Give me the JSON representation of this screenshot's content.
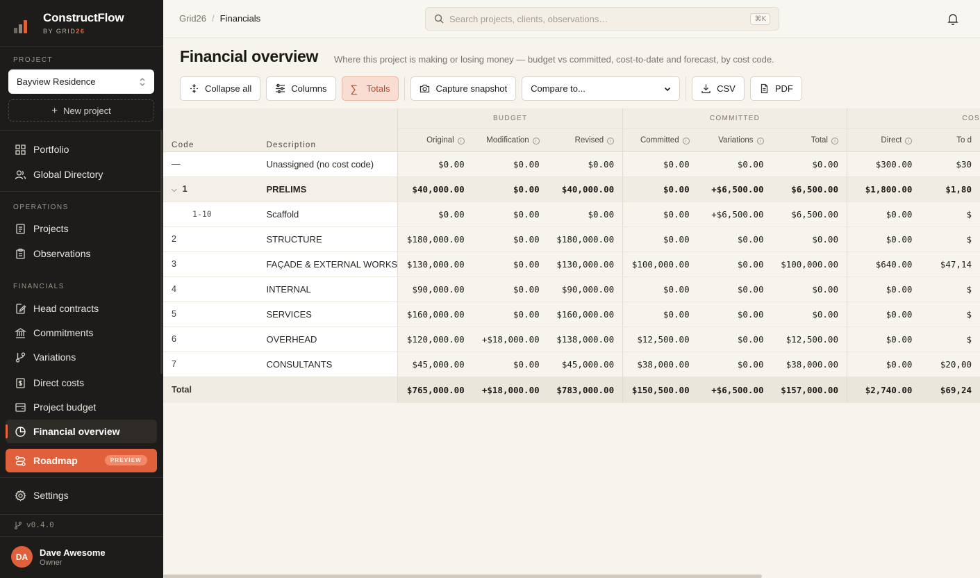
{
  "brand": {
    "name": "ConstructFlow",
    "sub_prefix": "BY GRID",
    "sub_accent": "26"
  },
  "sidebar": {
    "project_section": "PROJECT",
    "project_selected": "Bayview Residence",
    "new_project": "New project",
    "top_items": [
      {
        "label": "Portfolio",
        "icon": "grid-icon"
      },
      {
        "label": "Global Directory",
        "icon": "users-icon"
      }
    ],
    "operations_section": "OPERATIONS",
    "operations_items": [
      {
        "label": "Projects",
        "icon": "briefcase-icon"
      },
      {
        "label": "Observations",
        "icon": "clipboard-icon"
      }
    ],
    "financials_section": "FINANCIALS",
    "financials_items": [
      {
        "label": "Head contracts",
        "icon": "file-pen-icon"
      },
      {
        "label": "Commitments",
        "icon": "bank-icon"
      },
      {
        "label": "Variations",
        "icon": "branch-icon"
      },
      {
        "label": "Direct costs",
        "icon": "receipt-icon"
      },
      {
        "label": "Project budget",
        "icon": "folder-icon"
      },
      {
        "label": "Financial overview",
        "icon": "pie-chart-icon",
        "active": true
      }
    ],
    "roadmap": {
      "label": "Roadmap",
      "badge": "PREVIEW",
      "icon": "route-icon"
    },
    "settings": {
      "label": "Settings",
      "icon": "gear-icon"
    },
    "version": "v0.4.0",
    "user": {
      "initials": "DA",
      "name": "Dave Awesome",
      "role": "Owner"
    }
  },
  "topbar": {
    "breadcrumb_root": "Grid26",
    "breadcrumb_sep": "/",
    "breadcrumb_current": "Financials",
    "search_placeholder": "Search projects, clients, observations…",
    "search_shortcut": "⌘K"
  },
  "page": {
    "title": "Financial overview",
    "subtitle": "Where this project is making or losing money — budget vs committed, cost-to-date and forecast, by cost code."
  },
  "toolbar": {
    "collapse_all": "Collapse all",
    "columns": "Columns",
    "totals": "Totals",
    "capture_snapshot": "Capture snapshot",
    "compare_to": "Compare to...",
    "csv": "CSV",
    "pdf": "PDF"
  },
  "table": {
    "groups": {
      "budget": "BUDGET",
      "committed": "COMMITTED",
      "cost": "COS"
    },
    "headers": {
      "code": "Code",
      "description": "Description",
      "original": "Original",
      "modification": "Modification",
      "revised": "Revised",
      "committed": "Committed",
      "variations": "Variations",
      "total": "Total",
      "direct": "Direct",
      "to_date": "To d"
    },
    "rows": [
      {
        "code": "—",
        "desc": "Unassigned (no cost code)",
        "type": "plain",
        "values": [
          "$0.00",
          "$0.00",
          "$0.00",
          "$0.00",
          "$0.00",
          "$0.00",
          "$300.00",
          "$30"
        ]
      },
      {
        "code": "1",
        "desc": "PRELIMS",
        "type": "parent",
        "values": [
          "$40,000.00",
          "$0.00",
          "$40,000.00",
          "$0.00",
          "+$6,500.00",
          "$6,500.00",
          "$1,800.00",
          "$1,80"
        ]
      },
      {
        "code": "1-10",
        "desc": "Scaffold",
        "type": "child",
        "values": [
          "$0.00",
          "$0.00",
          "$0.00",
          "$0.00",
          "+$6,500.00",
          "$6,500.00",
          "$0.00",
          "$"
        ]
      },
      {
        "code": "2",
        "desc": "STRUCTURE",
        "type": "plain",
        "values": [
          "$180,000.00",
          "$0.00",
          "$180,000.00",
          "$0.00",
          "$0.00",
          "$0.00",
          "$0.00",
          "$"
        ]
      },
      {
        "code": "3",
        "desc": "FAÇADE & EXTERNAL WORKS",
        "type": "plain",
        "values": [
          "$130,000.00",
          "$0.00",
          "$130,000.00",
          "$100,000.00",
          "$0.00",
          "$100,000.00",
          "$640.00",
          "$47,14"
        ]
      },
      {
        "code": "4",
        "desc": "INTERNAL",
        "type": "plain",
        "values": [
          "$90,000.00",
          "$0.00",
          "$90,000.00",
          "$0.00",
          "$0.00",
          "$0.00",
          "$0.00",
          "$"
        ]
      },
      {
        "code": "5",
        "desc": "SERVICES",
        "type": "plain",
        "values": [
          "$160,000.00",
          "$0.00",
          "$160,000.00",
          "$0.00",
          "$0.00",
          "$0.00",
          "$0.00",
          "$"
        ]
      },
      {
        "code": "6",
        "desc": "OVERHEAD",
        "type": "plain",
        "values": [
          "$120,000.00",
          "+$18,000.00",
          "$138,000.00",
          "$12,500.00",
          "$0.00",
          "$12,500.00",
          "$0.00",
          "$"
        ]
      },
      {
        "code": "7",
        "desc": "CONSULTANTS",
        "type": "plain",
        "values": [
          "$45,000.00",
          "$0.00",
          "$45,000.00",
          "$38,000.00",
          "$0.00",
          "$38,000.00",
          "$0.00",
          "$20,00"
        ]
      }
    ],
    "total": {
      "label": "Total",
      "values": [
        "$765,000.00",
        "+$18,000.00",
        "$783,000.00",
        "$150,500.00",
        "+$6,500.00",
        "$157,000.00",
        "$2,740.00",
        "$69,24"
      ]
    }
  },
  "colors": {
    "accent": "#e0603c",
    "sidebar_bg": "#1e1c1a",
    "page_bg": "#f7f4ee"
  }
}
